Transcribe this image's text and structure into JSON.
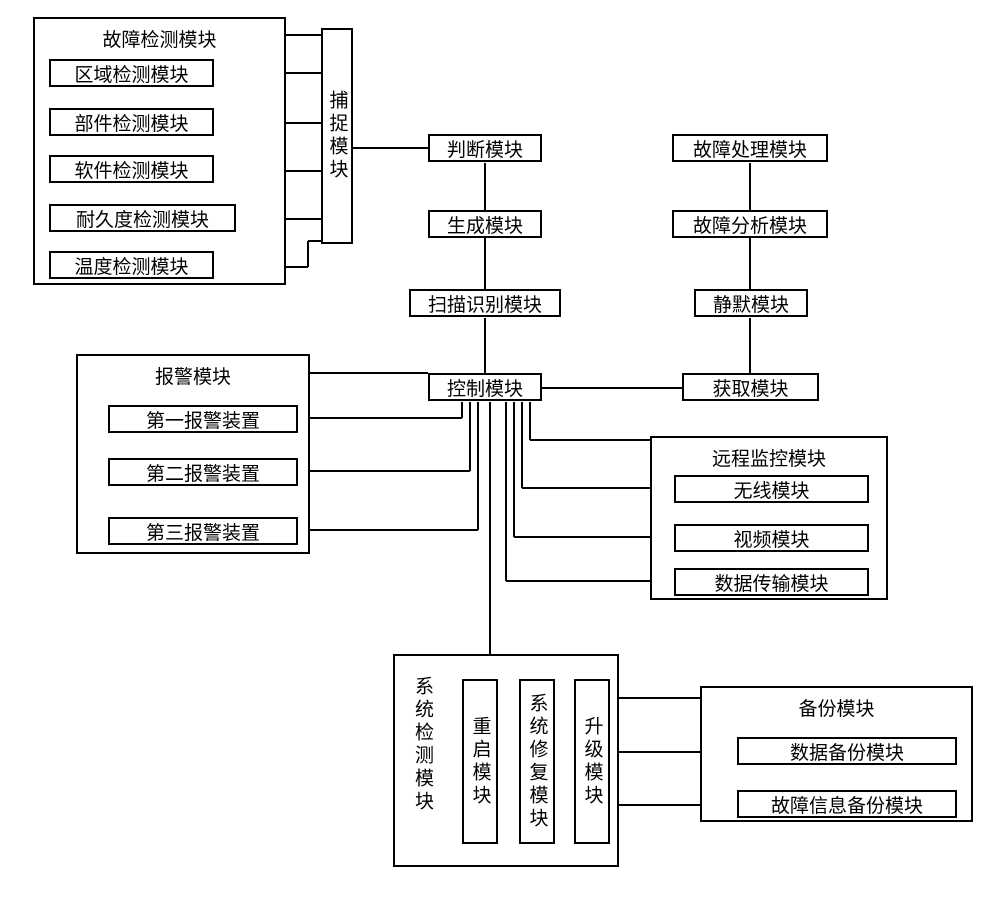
{
  "fault_detect": {
    "title": "故障检测模块",
    "items": [
      "区域检测模块",
      "部件检测模块",
      "软件检测模块",
      "耐久度检测模块",
      "温度检测模块"
    ]
  },
  "capture": "捕捉模块",
  "judge": "判断模块",
  "generate": "生成模块",
  "scan_identify": "扫描识别模块",
  "control": "控制模块",
  "acquire": "获取模块",
  "silent": "静默模块",
  "fault_analysis": "故障分析模块",
  "fault_process": "故障处理模块",
  "alarm": {
    "title": "报警模块",
    "items": [
      "第一报警装置",
      "第二报警装置",
      "第三报警装置"
    ]
  },
  "remote": {
    "title": "远程监控模块",
    "items": [
      "无线模块",
      "视频模块",
      "数据传输模块"
    ]
  },
  "sys_check": {
    "title": "系统检测模块",
    "items": [
      "重启模块",
      "系统修复模块",
      "升级模块"
    ]
  },
  "backup": {
    "title": "备份模块",
    "items": [
      "数据备份模块",
      "故障信息备份模块"
    ]
  }
}
